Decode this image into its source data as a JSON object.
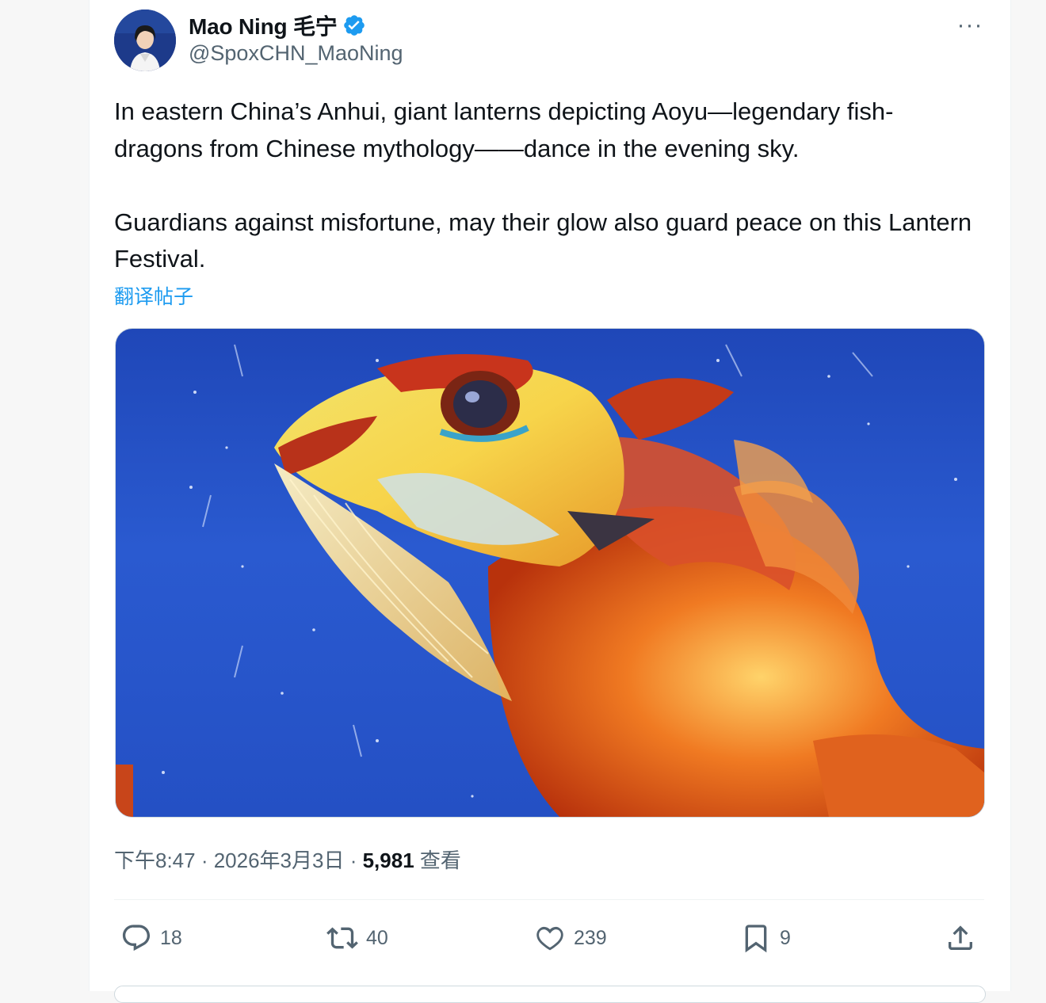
{
  "author": {
    "name": "Mao Ning 毛宁",
    "handle": "@SpoxCHN_MaoNing",
    "verified": true,
    "avatar_icon": "avatar"
  },
  "menu": {
    "more_label": "···"
  },
  "tweet": {
    "paragraphs": [
      "In eastern China’s Anhui, giant lanterns depicting Aoyu—legendary fish-dragons from Chinese mythology——dance in the evening sky.",
      "Guardians against misfortune, may their glow also guard peace on this Lantern Festival."
    ],
    "translate_label": "翻译帖子"
  },
  "meta": {
    "time": "下午8:47",
    "separator": " · ",
    "date": "2026年3月3日",
    "views_count": "5,981",
    "views_label": "查看"
  },
  "actions": {
    "reply": {
      "icon": "reply-icon",
      "count": "18"
    },
    "repost": {
      "icon": "repost-icon",
      "count": "40"
    },
    "like": {
      "icon": "heart-icon",
      "count": "239"
    },
    "bookmark": {
      "icon": "bookmark-icon",
      "count": "9"
    },
    "share": {
      "icon": "share-icon"
    }
  },
  "colors": {
    "accent": "#1d9bf0",
    "text_primary": "#0f1419",
    "text_secondary": "#536471",
    "sky_blue": "#2450c4",
    "lantern_orange": "#e8561c"
  }
}
